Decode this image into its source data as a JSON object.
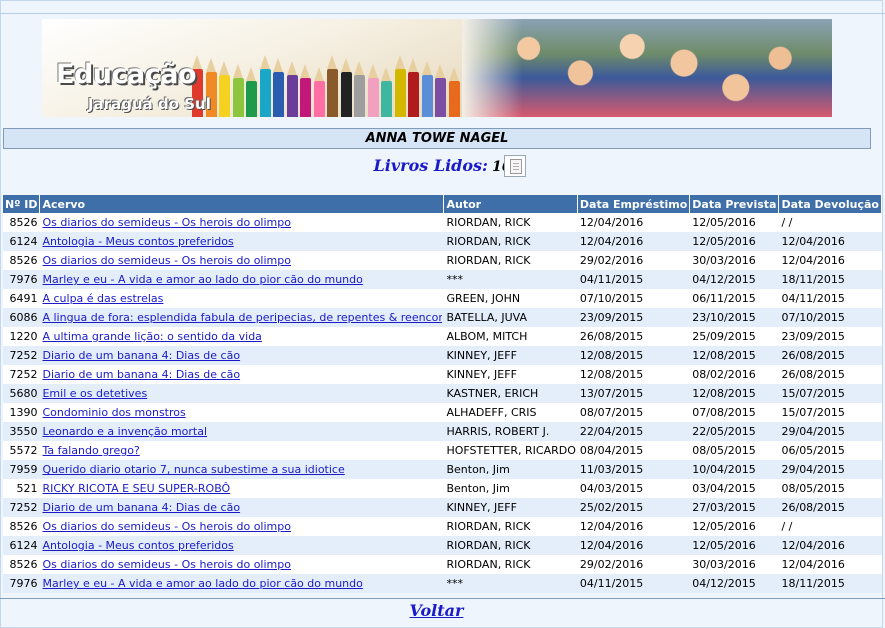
{
  "banner": {
    "brand": "Educação",
    "city": "Jaraguá do Sul"
  },
  "student": {
    "name": "ANNA TOWE NAGEL"
  },
  "summary": {
    "label": "Livros Lidos:",
    "count": "16"
  },
  "table": {
    "headers": [
      "Nº ID",
      "Acervo",
      "Autor",
      "Data Empréstimo",
      "Data Prevista",
      "Data Devolução"
    ],
    "rows": [
      {
        "id": "8526",
        "title": "Os diarios do semideus - Os herois do olimpo",
        "author": "RIORDAN, RICK",
        "loan": "12/04/2016",
        "due": "12/05/2016",
        "returned": "/ /"
      },
      {
        "id": "6124",
        "title": "Antologia - Meus contos preferidos",
        "author": "RIORDAN, RICK",
        "loan": "12/04/2016",
        "due": "12/05/2016",
        "returned": "12/04/2016"
      },
      {
        "id": "8526",
        "title": "Os diarios do semideus - Os herois do olimpo",
        "author": "RIORDAN, RICK",
        "loan": "29/02/2016",
        "due": "30/03/2016",
        "returned": "12/04/2016"
      },
      {
        "id": "7976",
        "title": "Marley e eu - A vida e amor ao lado do pior cão do mundo",
        "author": "***",
        "loan": "04/11/2015",
        "due": "04/12/2015",
        "returned": "18/11/2015"
      },
      {
        "id": "6491",
        "title": "A culpa é das estrelas",
        "author": "GREEN, JOHN",
        "loan": "07/10/2015",
        "due": "06/11/2015",
        "returned": "04/11/2015"
      },
      {
        "id": "6086",
        "title": "A lingua de fora: esplendida fabula de peripecias, de repentes & reencontros",
        "author": "BATELLA, JUVA",
        "loan": "23/09/2015",
        "due": "23/10/2015",
        "returned": "07/10/2015"
      },
      {
        "id": "1220",
        "title": "A ultima grande lição: o sentido da vida",
        "author": "ALBOM, MITCH",
        "loan": "26/08/2015",
        "due": "25/09/2015",
        "returned": "23/09/2015"
      },
      {
        "id": "7252",
        "title": "Diario de um banana 4: Dias de cão",
        "author": "KINNEY, JEFF",
        "loan": "12/08/2015",
        "due": "12/08/2015",
        "returned": "26/08/2015"
      },
      {
        "id": "7252",
        "title": "Diario de um banana 4: Dias de cão",
        "author": "KINNEY, JEFF",
        "loan": "12/08/2015",
        "due": "08/02/2016",
        "returned": "26/08/2015"
      },
      {
        "id": "5680",
        "title": "Emil e os detetives",
        "author": "KASTNER, ERICH",
        "loan": "13/07/2015",
        "due": "12/08/2015",
        "returned": "15/07/2015"
      },
      {
        "id": "1390",
        "title": "Condominio dos monstros",
        "author": "ALHADEFF, CRIS",
        "loan": "08/07/2015",
        "due": "07/08/2015",
        "returned": "15/07/2015"
      },
      {
        "id": "3550",
        "title": "Leonardo e a invenção mortal",
        "author": "HARRIS, ROBERT J.",
        "loan": "22/04/2015",
        "due": "22/05/2015",
        "returned": "29/04/2015"
      },
      {
        "id": "5572",
        "title": "Ta falando grego?",
        "author": "HOFSTETTER, RICARDO",
        "loan": "08/04/2015",
        "due": "08/05/2015",
        "returned": "06/05/2015"
      },
      {
        "id": "7959",
        "title": "Querido diario otario 7, nunca subestime a sua idiotice",
        "author": "Benton, Jim",
        "loan": "11/03/2015",
        "due": "10/04/2015",
        "returned": "29/04/2015"
      },
      {
        "id": "521",
        "title": "RICKY RICOTA E SEU SUPER-ROBÔ",
        "author": "Benton, Jim",
        "loan": "04/03/2015",
        "due": "03/04/2015",
        "returned": "08/05/2015"
      },
      {
        "id": "7252",
        "title": "Diario de um banana 4: Dias de cão",
        "author": "KINNEY, JEFF",
        "loan": "25/02/2015",
        "due": "27/03/2015",
        "returned": "26/08/2015"
      },
      {
        "id": "8526",
        "title": "Os diarios do semideus - Os herois do olimpo",
        "author": "RIORDAN, RICK",
        "loan": "12/04/2016",
        "due": "12/05/2016",
        "returned": "/ /"
      },
      {
        "id": "6124",
        "title": "Antologia - Meus contos preferidos",
        "author": "RIORDAN, RICK",
        "loan": "12/04/2016",
        "due": "12/05/2016",
        "returned": "12/04/2016"
      },
      {
        "id": "8526",
        "title": "Os diarios do semideus - Os herois do olimpo",
        "author": "RIORDAN, RICK",
        "loan": "29/02/2016",
        "due": "30/03/2016",
        "returned": "12/04/2016"
      },
      {
        "id": "7976",
        "title": "Marley e eu - A vida e amor ao lado do pior cão do mundo",
        "author": "***",
        "loan": "04/11/2015",
        "due": "04/12/2015",
        "returned": "18/11/2015"
      }
    ]
  },
  "footer": {
    "back_label": "Voltar"
  },
  "colors": {
    "header_bg": "#3f6fa8",
    "row_alt_bg": "#e3eefa",
    "link": "#1a1ac8",
    "page_bg": "#eef5fc"
  },
  "icons": {
    "print": "print-page-icon"
  }
}
